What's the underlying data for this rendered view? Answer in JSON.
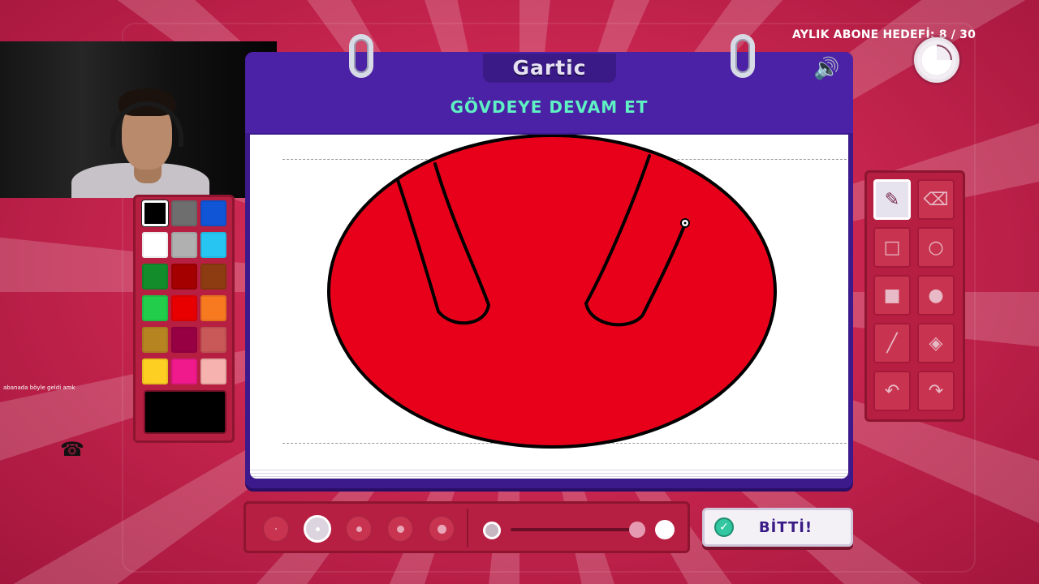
{
  "stream": {
    "goal_text": "AYLIK ABONE HEDEFİ: 8 / 30",
    "chat": {
      "user": "",
      "message": "abanada böyle geldi amk"
    }
  },
  "game": {
    "logo": "Gartic",
    "prompt": "GÖVDEYE DEVAM ET",
    "done_label": "BİTTİ!",
    "timer_remaining_fraction": 0.75
  },
  "palette": {
    "colors": [
      "#000000",
      "#6e6e6e",
      "#1055d6",
      "#ffffff",
      "#b0b0b0",
      "#27c6f2",
      "#138c2c",
      "#a40000",
      "#8c3c10",
      "#21cd4a",
      "#e80000",
      "#f77a21",
      "#b78422",
      "#980044",
      "#c95858",
      "#fdcf22",
      "#f01a8c",
      "#f6b2ae"
    ],
    "selected_index": 0,
    "current_color": "#000000"
  },
  "tools": {
    "items": [
      "pencil-icon",
      "eraser-icon",
      "rectangle-outline-icon",
      "circle-outline-icon",
      "rectangle-filled-icon",
      "circle-filled-icon",
      "line-icon",
      "fill-bucket-icon",
      "undo-icon",
      "redo-icon"
    ],
    "selected": "pencil-icon"
  },
  "brush": {
    "sizes": 5,
    "selected_size_index": 1
  },
  "canvas": {
    "fill_color": "#e8001a",
    "stroke_color": "#000000"
  },
  "colors": {
    "accent_purple": "#4b22a6",
    "prompt_green": "#5ff0c4",
    "panel_red": "#b61f41"
  }
}
